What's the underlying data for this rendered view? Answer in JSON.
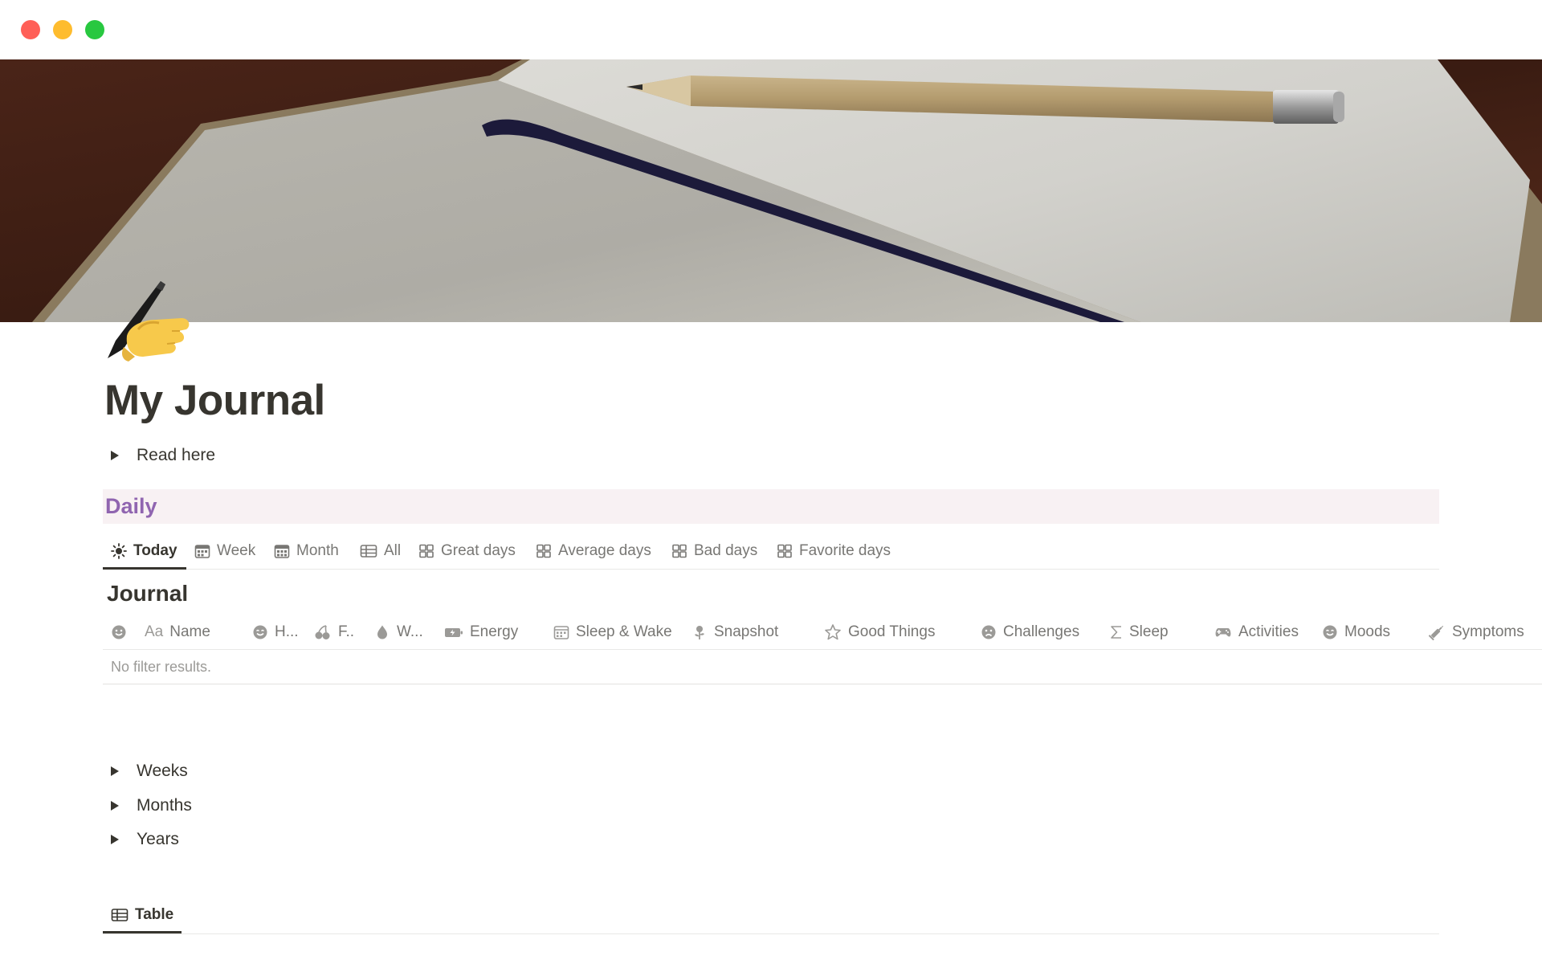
{
  "window": {
    "controls": [
      "close",
      "minimize",
      "zoom"
    ]
  },
  "page": {
    "icon": "writing-hand-emoji",
    "title": "My Journal",
    "read_toggle": "Read here"
  },
  "daily": {
    "heading": "Daily",
    "tabs": [
      {
        "label": "Today",
        "icon": "sun-icon",
        "active": true
      },
      {
        "label": "Week",
        "icon": "calendar-icon"
      },
      {
        "label": "Month",
        "icon": "calendar-icon"
      },
      {
        "label": "All",
        "icon": "table-icon"
      },
      {
        "label": "Great days",
        "icon": "gallery-icon"
      },
      {
        "label": "Average days",
        "icon": "gallery-icon"
      },
      {
        "label": "Bad days",
        "icon": "gallery-icon"
      },
      {
        "label": "Favorite days",
        "icon": "gallery-icon"
      }
    ]
  },
  "journal": {
    "title": "Journal",
    "columns": [
      {
        "label": "",
        "icon": "smiley-icon"
      },
      {
        "label": "Name",
        "prefix": "Aa",
        "icon": "title-icon"
      },
      {
        "label": "H...",
        "icon": "smiley-icon"
      },
      {
        "label": "F..",
        "icon": "cherries-icon"
      },
      {
        "label": "W...",
        "icon": "droplet-icon"
      },
      {
        "label": "Energy",
        "icon": "battery-icon"
      },
      {
        "label": "Sleep & Wake",
        "icon": "calendar-icon"
      },
      {
        "label": "Snapshot",
        "icon": "plant-icon"
      },
      {
        "label": "Good Things",
        "icon": "star-icon"
      },
      {
        "label": "Challenges",
        "icon": "sad-face-icon"
      },
      {
        "label": "Sleep",
        "icon": "sigma-icon"
      },
      {
        "label": "Activities",
        "icon": "gamepad-icon"
      },
      {
        "label": "Moods",
        "icon": "smiley-icon"
      },
      {
        "label": "Symptoms",
        "icon": "syringe-icon"
      }
    ],
    "empty_message": "No filter results."
  },
  "sections": [
    "Weeks",
    "Months",
    "Years"
  ],
  "bottom_view": {
    "label": "Table",
    "icon": "table-icon"
  }
}
